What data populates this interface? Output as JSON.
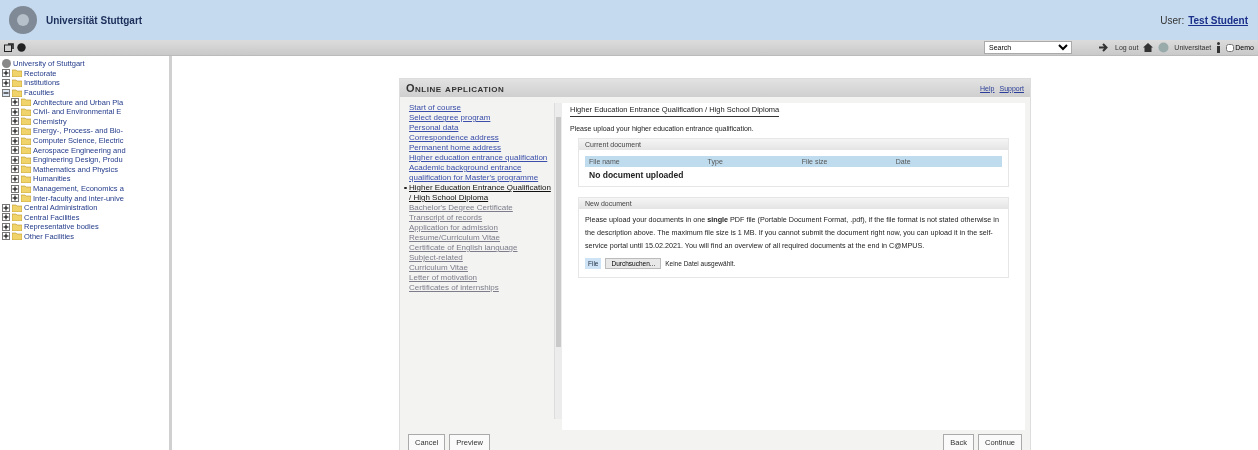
{
  "header": {
    "site_name": "Universität Stuttgart",
    "user_label": "User:",
    "user_name": "Test Student"
  },
  "toolbar": {
    "search_select": "Search",
    "logout": "Log out",
    "language_link": "Universitaet",
    "demo": {
      "label": "Demo",
      "checked": false
    }
  },
  "tree": {
    "root": "University of Stuttgart",
    "items": [
      {
        "label": "Rectorate",
        "expanded": false
      },
      {
        "label": "Institutions",
        "expanded": false
      },
      {
        "label": "Faculties",
        "expanded": true,
        "children": [
          {
            "label": "Architecture and Urban Pla",
            "expanded": false
          },
          {
            "label": "Civil- and Environmental E",
            "expanded": false
          },
          {
            "label": "Chemistry",
            "expanded": false
          },
          {
            "label": "Energy-, Process- and Bio-",
            "expanded": false
          },
          {
            "label": "Computer Science, Electric",
            "expanded": false
          },
          {
            "label": "Aerospace Engineering and",
            "expanded": false
          },
          {
            "label": "Engineering Design, Produ",
            "expanded": false
          },
          {
            "label": "Mathematics and Physics",
            "expanded": false
          },
          {
            "label": "Humanities",
            "expanded": false
          },
          {
            "label": "Management, Economics a",
            "expanded": false
          },
          {
            "label": "Inter-faculty and inter-unive",
            "expanded": false
          }
        ]
      },
      {
        "label": "Central Administration",
        "expanded": false
      },
      {
        "label": "Central Facilities",
        "expanded": false
      },
      {
        "label": "Representative bodies",
        "expanded": false
      },
      {
        "label": "Other Facilities",
        "expanded": false
      }
    ]
  },
  "application": {
    "title": "Online application",
    "links": [
      "Help",
      "Support"
    ],
    "steps": [
      {
        "label": "Start of course",
        "selected": false,
        "disabled": false
      },
      {
        "label": "Select degree program",
        "selected": false,
        "disabled": false
      },
      {
        "label": "Personal data",
        "selected": false,
        "disabled": false
      },
      {
        "label": "Correspondence address",
        "selected": false,
        "disabled": false
      },
      {
        "label": "Permanent home address",
        "selected": false,
        "disabled": false
      },
      {
        "label": "Higher education entrance qualification",
        "selected": false,
        "disabled": false
      },
      {
        "label": "Academic background entrance qualification for Master's programme",
        "selected": false,
        "disabled": false
      },
      {
        "label": "Higher Education Entrance Qualification / High School Diploma",
        "selected": true,
        "disabled": false
      },
      {
        "label": "Bachelor's Degree Certificate",
        "selected": false,
        "disabled": true
      },
      {
        "label": "Transcript of records",
        "selected": false,
        "disabled": true
      },
      {
        "label": "Application for admission",
        "selected": false,
        "disabled": true
      },
      {
        "label": "Resume/Curriculum Vitae",
        "selected": false,
        "disabled": true
      },
      {
        "label": "Certificate of English language",
        "selected": false,
        "disabled": true
      },
      {
        "label": "Subject-related",
        "selected": false,
        "disabled": true
      },
      {
        "label": "Curriculum Vitae",
        "selected": false,
        "disabled": true
      },
      {
        "label": "Letter of motivation",
        "selected": false,
        "disabled": true
      },
      {
        "label": "Certificates of internships",
        "selected": false,
        "disabled": true
      }
    ],
    "heading": "Higher Education Entrance Qualification / High School Diploma",
    "intro": "Please upload your higher education entrance qualification.",
    "current": {
      "title": "Current document",
      "columns": [
        "File name",
        "Type",
        "File size",
        "Date"
      ],
      "empty": "No document uploaded"
    },
    "new": {
      "title": "New document",
      "text": "Please upload your documents in one **single** PDF file (Portable Document Format, .pdf), if the file format is not stated otherwise in the description above. The maximum file size is 1 MB. If you cannot submit the document right now, you can upload it in the self-service portal until 15.02.2021. You will find an overview of all required documents at the end in C@MPUS.",
      "file_label": "File",
      "browse": "Durchsuchen...",
      "no_file": "Keine Datei ausgewählt."
    },
    "buttons_left": [
      "Cancel",
      "Preview"
    ],
    "buttons_right": [
      "Back",
      "Continue"
    ]
  }
}
